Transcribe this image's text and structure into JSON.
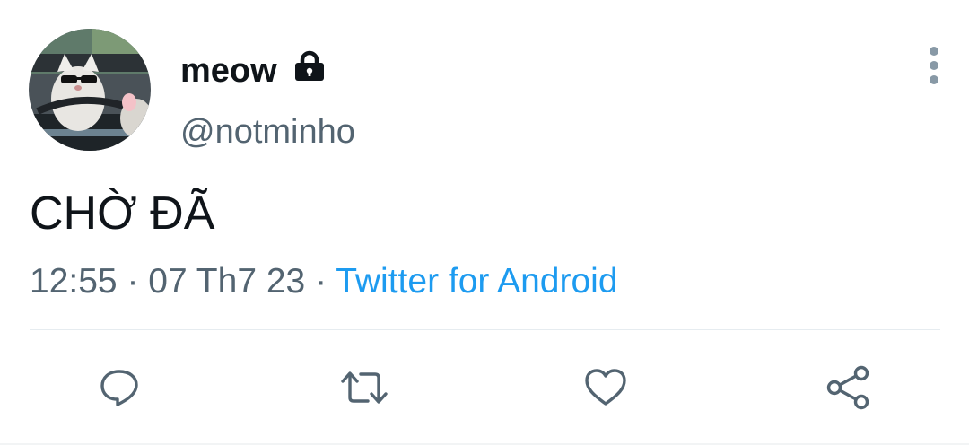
{
  "author": {
    "display_name": "meow",
    "handle": "@notminho",
    "avatar_icon": "cat-driving-avatar",
    "lock_icon": "lock-icon"
  },
  "tweet": {
    "text": "CHỜ ĐÃ",
    "time": "12:55",
    "separator": "·",
    "date": "07 Th7 23",
    "source": "Twitter for Android"
  },
  "actions": {
    "reply_icon": "reply-icon",
    "retweet_icon": "retweet-icon",
    "like_icon": "heart-icon",
    "share_icon": "share-icon"
  },
  "colors": {
    "primary_text": "#0f1419",
    "secondary_text": "#536471",
    "link": "#1d9bf0",
    "icon": "#536471"
  }
}
